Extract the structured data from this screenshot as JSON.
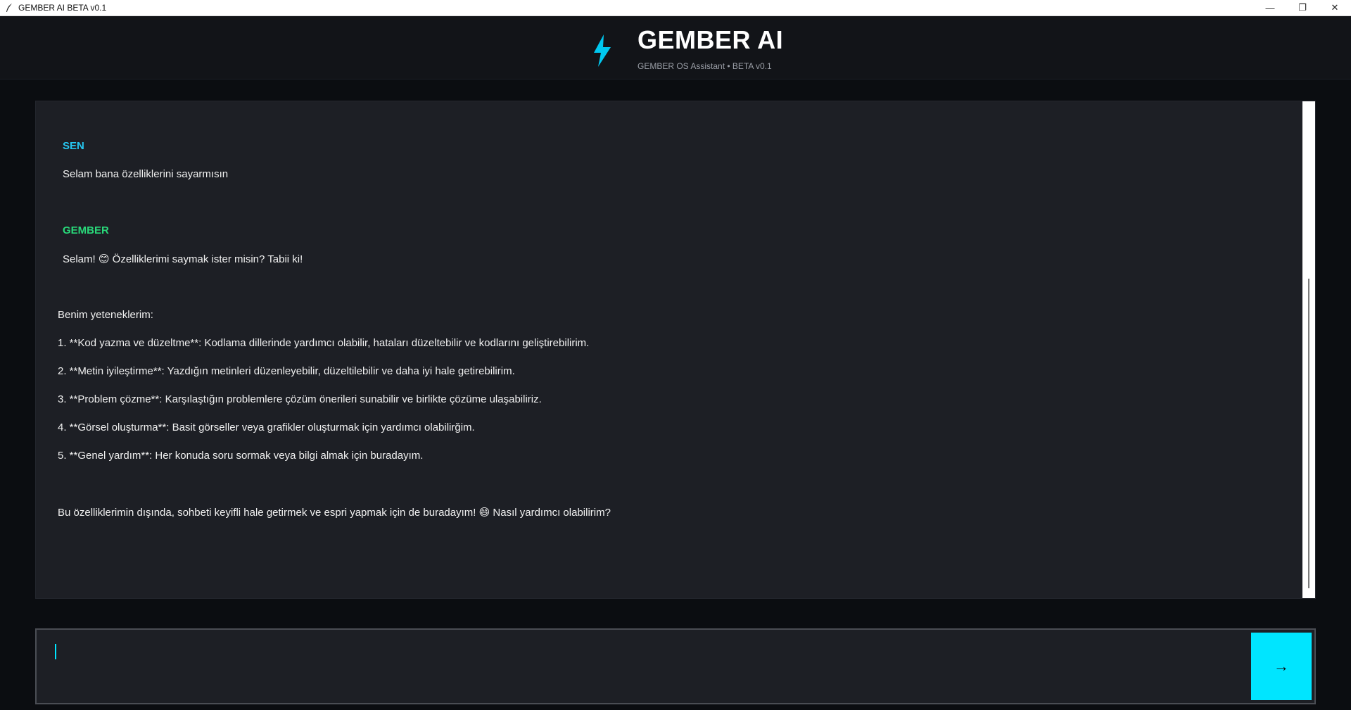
{
  "window": {
    "title": "GEMBER AI BETA v0.1",
    "minimize_glyph": "—",
    "maximize_glyph": "❐",
    "close_glyph": "✕"
  },
  "header": {
    "title": "GEMBER AI",
    "subtitle": "GEMBER OS Assistant • BETA v0.1",
    "logo_icon": "lightning-bolt-icon",
    "accent_color": "#00e5ff"
  },
  "chat": {
    "user_label": "SEN",
    "user_message": "Selam bana özelliklerini sayarmısın",
    "assistant_label": "GEMBER",
    "assistant_lines": [
      "Selam! 😊 Özelliklerimi saymak ister misin? Tabii ki!",
      "Benim yeteneklerim:",
      "1. **Kod yazma ve düzeltme**: Kodlama dillerinde yardımcı olabilir, hataları düzeltebilir ve kodlarını geliştirebilirim.",
      "2. **Metin iyileştirme**: Yazdığın metinleri düzenleyebilir, düzeltilebilir ve daha iyi hale getirebilirim.",
      "3. **Problem çözme**: Karşılaştığın problemlere çözüm önerileri sunabilir ve birlikte çözüme ulaşabiliriz.",
      "4. **Görsel oluşturma**: Basit görseller veya grafikler oluşturmak için yardımcı olabilirğim.",
      "5. **Genel yardım**: Her konuda soru sormak veya bilgi almak için buradayım.",
      "Bu özelliklerimin dışında, sohbeti keyifli hale getirmek ve espri yapmak için de buradayım! 😄 Nasıl yardımcı olabilirim?"
    ],
    "user_label_color": "#26c6f0",
    "assistant_label_color": "#29d97a"
  },
  "input": {
    "value": "",
    "send_label": "→"
  }
}
